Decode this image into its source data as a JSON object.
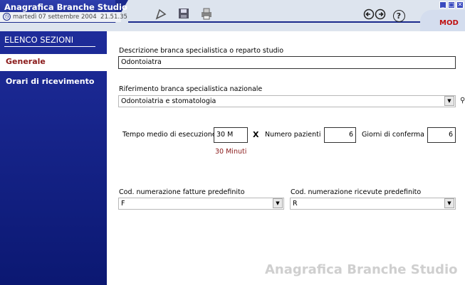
{
  "window": {
    "title": "Anagrafica Branche Studio",
    "date": "martedì 07 settembre 2004",
    "time": "21.51.35",
    "mode": "MOD"
  },
  "toolbar": {
    "icons": [
      "pin-icon",
      "save-icon",
      "print-icon",
      "back-icon",
      "forward-icon",
      "help-icon"
    ],
    "help_label": "?"
  },
  "sidebar": {
    "title": "ELENCO SEZIONI",
    "items": [
      {
        "label": "Generale",
        "active": true
      },
      {
        "label": "Orari di ricevimento",
        "active": false
      }
    ]
  },
  "form": {
    "descrizione_label": "Descrizione branca specialistica o reparto studio",
    "descrizione_value": "Odontoiatra",
    "riferimento_label": "Riferimento branca specialistica nazionale",
    "riferimento_value": "Odontoiatria e stomatologia",
    "tempo_label": "Tempo medio di esecuzione",
    "tempo_value": "30 M",
    "tempo_hint": "30 Minuti",
    "times_symbol": "X",
    "pazienti_label": "Numero pazienti",
    "pazienti_value": "6",
    "giorni_label": "Giorni di conferma",
    "giorni_value": "6",
    "fatture_label": "Cod. numerazione fatture predefinito",
    "fatture_value": "F",
    "ricevute_label": "Cod. numerazione ricevute predefinito",
    "ricevute_value": "R"
  },
  "watermark": "Anagrafica Branche Studio",
  "colors": {
    "sidebar": "#1b2a8c",
    "accent_red": "#c01010",
    "hint": "#8a1a1a"
  }
}
